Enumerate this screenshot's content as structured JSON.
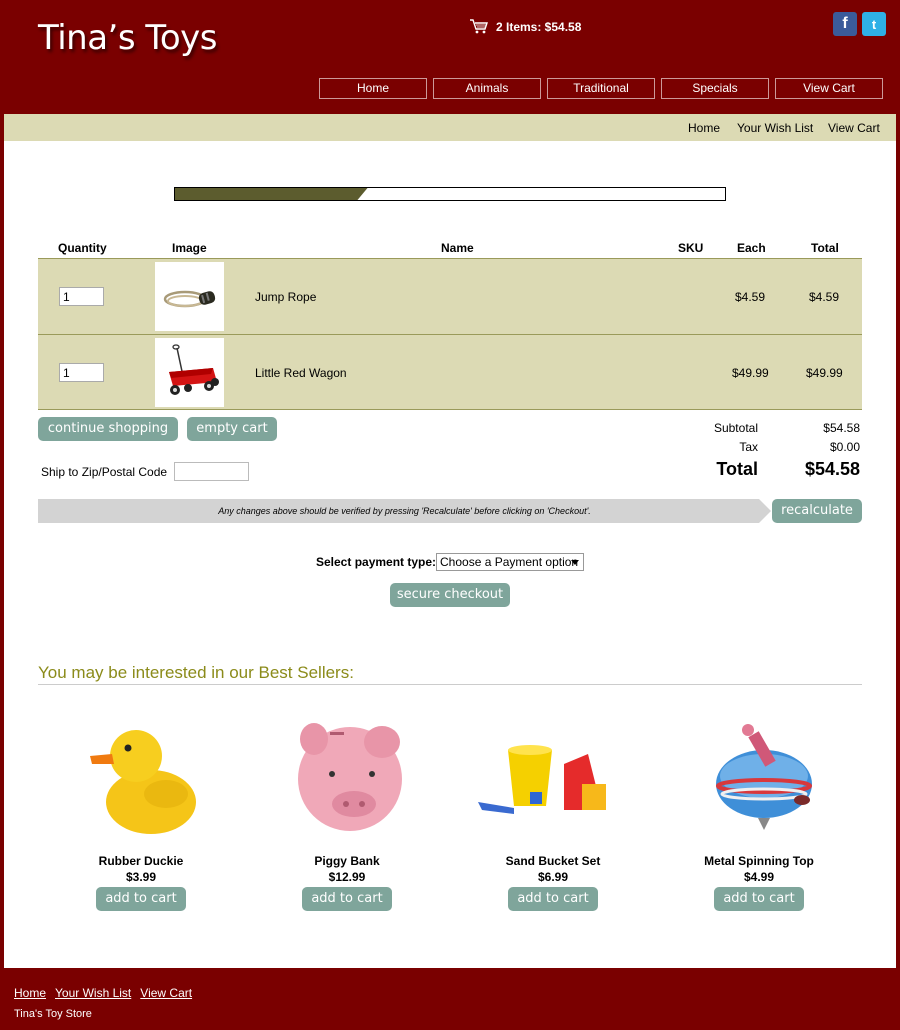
{
  "header": {
    "store_name": "Tina’s Toys",
    "cart_summary": "2 Items: $54.58",
    "social": [
      "facebook-icon",
      "twitter-icon"
    ],
    "nav": [
      "Home",
      "Animals",
      "Traditional",
      "Specials",
      "View Cart"
    ]
  },
  "subnav": [
    "Home",
    "Your Wish List",
    "View Cart"
  ],
  "checkout_progress": 0.35,
  "cart": {
    "columns": [
      "Quantity",
      "Image",
      "Name",
      "SKU",
      "Each",
      "Total"
    ],
    "items": [
      {
        "qty": "1",
        "name": "Jump Rope",
        "sku": "",
        "each": "$4.59",
        "total": "$4.59"
      },
      {
        "qty": "1",
        "name": "Little Red Wagon",
        "sku": "",
        "each": "$49.99",
        "total": "$49.99"
      }
    ],
    "continue_label": "continue shopping",
    "empty_label": "empty cart",
    "subtotal_label": "Subtotal",
    "subtotal": "$54.58",
    "tax_label": "Tax",
    "tax": "$0.00",
    "total_label": "Total",
    "total": "$54.58",
    "zip_label": "Ship to Zip/Postal Code",
    "zip_value": "",
    "notice": "Any changes above should be verified by pressing 'Recalculate' before clicking on 'Checkout'.",
    "recalculate_label": "recalculate"
  },
  "payment": {
    "label": "Select payment type:",
    "selected": "Choose a Payment option",
    "checkout_label": "secure checkout"
  },
  "bestsellers": {
    "title": "You may be interested in our Best Sellers:",
    "add_label": "add to cart",
    "items": [
      {
        "name": "Rubber Duckie",
        "price": "$3.99"
      },
      {
        "name": "Piggy Bank",
        "price": "$12.99"
      },
      {
        "name": "Sand Bucket Set",
        "price": "$6.99"
      },
      {
        "name": "Metal Spinning Top",
        "price": "$4.99"
      }
    ]
  },
  "footer": {
    "links": [
      "Home",
      "Your Wish List",
      "View Cart"
    ],
    "store": "Tina's Toy Store"
  }
}
